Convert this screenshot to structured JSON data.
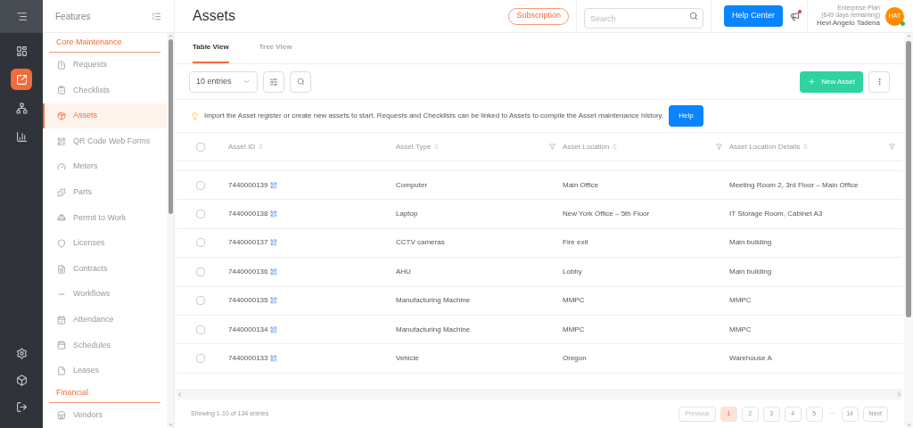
{
  "rail": {
    "items": [
      {
        "kind": "top",
        "selected": false
      },
      {
        "kind": "main",
        "selected": false
      },
      {
        "kind": "main",
        "selected": true
      },
      {
        "kind": "main",
        "selected": false
      },
      {
        "kind": "main",
        "selected": false
      },
      {
        "kind": "bottom",
        "selected": false
      },
      {
        "kind": "bottom",
        "selected": false
      },
      {
        "kind": "bottom",
        "selected": false
      }
    ]
  },
  "sidebar": {
    "title": "Features",
    "sections": [
      {
        "title": "Core Maintenance",
        "items": [
          {
            "label": "Requests",
            "selected": false
          },
          {
            "label": "Checklists",
            "selected": false
          },
          {
            "label": "Assets",
            "selected": true
          },
          {
            "label": "QR Code Web Forms",
            "selected": false
          },
          {
            "label": "Meters",
            "selected": false
          },
          {
            "label": "Parts",
            "selected": false
          },
          {
            "label": "Permit to Work",
            "selected": false
          },
          {
            "label": "Licenses",
            "selected": false
          },
          {
            "label": "Contracts",
            "selected": false
          },
          {
            "label": "Workflows",
            "selected": false
          },
          {
            "label": "Attendance",
            "selected": false
          },
          {
            "label": "Schedules",
            "selected": false
          },
          {
            "label": "Leases",
            "selected": false
          }
        ]
      },
      {
        "title": "Financial",
        "items": [
          {
            "label": "Vendors",
            "selected": false
          }
        ]
      }
    ]
  },
  "header": {
    "title": "Assets",
    "subscription": "Subscription",
    "search": {
      "placeholder": "Search"
    },
    "help_center": "Help Center",
    "notification": true,
    "plan": "Enterprise Plan",
    "plan_remaining": "(649 days remaining)",
    "user": "Hevi Angelo Tadena",
    "avatar": "HAT",
    "online": true
  },
  "tabs": [
    {
      "label": "Table View",
      "selected": true
    },
    {
      "label": "Tree View",
      "selected": false
    }
  ],
  "toolbar": {
    "entries": "10 entries",
    "new_asset": "New Asset"
  },
  "notice": {
    "text": "Import the Asset register or create new assets to start. Requests and Checklists can be linked to Assets to compile the Asset maintenance history.",
    "button": "Help"
  },
  "table": {
    "select_all_checked": false,
    "columns": [
      {
        "label": "Asset ID",
        "filter": false
      },
      {
        "label": "Asset Type",
        "filter": true
      },
      {
        "label": "Asset Location",
        "filter": true
      },
      {
        "label": "Asset Location Details",
        "filter": true
      }
    ],
    "rows": [
      {
        "id": "7440000139",
        "type": "Computer",
        "location": "Main Office",
        "details": "Meeting Room 2, 3rd Floor – Main Office",
        "checked": false
      },
      {
        "id": "7440000138",
        "type": "Laptop",
        "location": "New York Office – 5th Floor",
        "details": "IT Storage Room, Cabinet A3",
        "checked": false
      },
      {
        "id": "7440000137",
        "type": "CCTV cameras",
        "location": "Fire exit",
        "details": "Main building",
        "checked": false
      },
      {
        "id": "7440000136",
        "type": "AHU",
        "location": "Lobby",
        "details": "Main building",
        "checked": false
      },
      {
        "id": "7440000135",
        "type": "Manufacturing Machine",
        "location": "MMPC",
        "details": "MMPC",
        "checked": false
      },
      {
        "id": "7440000134",
        "type": "Manufacturing Machine",
        "location": "MMPC",
        "details": "MMPC",
        "checked": false
      },
      {
        "id": "7440000133",
        "type": "Vehicle",
        "location": "Oregon",
        "details": "Warehouse A",
        "checked": false
      }
    ]
  },
  "footer": {
    "summary": "Showing 1-10 of 134 entries",
    "previous": "Previous",
    "pages": [
      {
        "label": "1",
        "selected": true
      },
      {
        "label": "2",
        "selected": false
      },
      {
        "label": "3",
        "selected": false
      },
      {
        "label": "4",
        "selected": false
      },
      {
        "label": "5",
        "selected": false
      },
      {
        "label": "14",
        "selected": false
      }
    ],
    "ellipsis": "···",
    "next": "Next"
  }
}
